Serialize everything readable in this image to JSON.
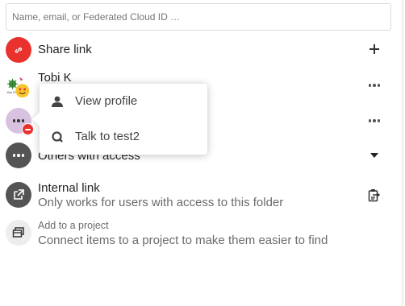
{
  "search": {
    "placeholder": "Name, email, or Federated Cloud ID …"
  },
  "share_link": {
    "label": "Share link"
  },
  "user_share": {
    "name": "Tobi K"
  },
  "others": {
    "label": "Others with access"
  },
  "internal_link": {
    "title": "Internal link",
    "subtitle": "Only works for users with access to this folder"
  },
  "project": {
    "title": "Add to a project",
    "subtitle": "Connect items to a project to make them easier to find"
  },
  "menu": {
    "items": [
      {
        "label": "View profile",
        "icon": "person-icon"
      },
      {
        "label": "Talk to test2",
        "icon": "talk-icon"
      }
    ]
  },
  "colors": {
    "share_link_accent": "#e9322d",
    "neutral_avatar": "#545454",
    "group_avatar": "#d9c2e0",
    "blocked_badge": "#e9322d"
  }
}
